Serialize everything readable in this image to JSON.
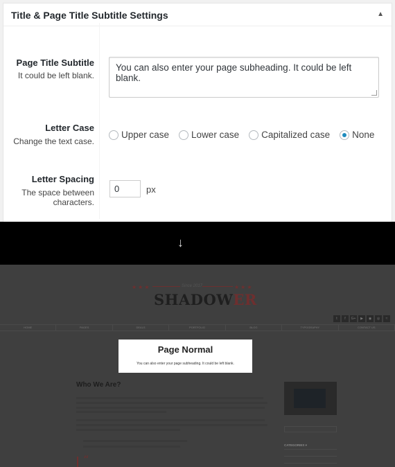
{
  "settings": {
    "box_title": "Title & Page Title Subtitle Settings",
    "collapse_glyph": "▲",
    "subtitle_label": "Page Title Subtitle",
    "subtitle_desc": "It could be left blank.",
    "subtitle_value": "You can also enter your page subheading. It could be left blank.",
    "letter_case_label": "Letter Case",
    "letter_case_desc": "Change the text case.",
    "letter_case_options": [
      "Upper case",
      "Lower case",
      "Capitalized case",
      "None"
    ],
    "letter_case_selected": "None",
    "letter_spacing_label": "Letter Spacing",
    "letter_spacing_desc_1": "The space between",
    "letter_spacing_desc_2": "characters.",
    "letter_spacing_value": "0",
    "letter_spacing_unit": "px"
  },
  "arrow": "↓",
  "preview": {
    "since": "Since 2017",
    "logo_main": "SHADOW",
    "logo_accent": "ER",
    "nav": [
      "HOME",
      "PAGES",
      "DEALS",
      "PORTFOLIO",
      "BLOG",
      "TYPOGRAPHY",
      "CONTACT US"
    ],
    "social_icons": [
      "twitter-icon",
      "facebook-icon",
      "google-plus-icon",
      "youtube-icon",
      "dribbble-icon",
      "instagram-icon",
      "rss-icon"
    ],
    "page_title": "Page Normal",
    "page_subtitle": "You can also enter your page subheading. It could be left blank.",
    "section_heading": "Who We Are?",
    "categories_label": "CATEGORIES ▾",
    "quote_glyph": "“"
  },
  "colors": {
    "accent": "#1e8cbe",
    "brand": "#6e2f2f"
  }
}
